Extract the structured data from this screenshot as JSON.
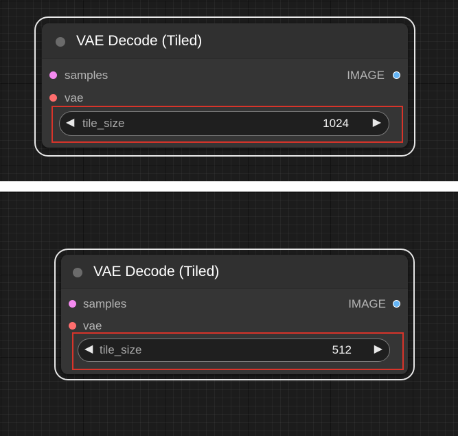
{
  "nodes": [
    {
      "title": "VAE Decode (Tiled)",
      "inputs": [
        {
          "label": "samples",
          "color": "#f48af0"
        },
        {
          "label": "vae",
          "color": "#ff6e6e"
        }
      ],
      "output": {
        "label": "IMAGE",
        "color": "#64b5f6"
      },
      "widget": {
        "name": "tile_size",
        "value": "1024",
        "left_arrow": "◀",
        "right_arrow": "▶"
      },
      "highlighted": true
    },
    {
      "title": "VAE Decode (Tiled)",
      "inputs": [
        {
          "label": "samples",
          "color": "#f48af0"
        },
        {
          "label": "vae",
          "color": "#ff6e6e"
        }
      ],
      "output": {
        "label": "IMAGE",
        "color": "#64b5f6"
      },
      "widget": {
        "name": "tile_size",
        "value": "512",
        "left_arrow": "◀",
        "right_arrow": "▶"
      },
      "highlighted": true
    }
  ],
  "colors": {
    "highlight": "#d8342a",
    "canvas": "#1c1c1c",
    "node_body": "#353535"
  }
}
